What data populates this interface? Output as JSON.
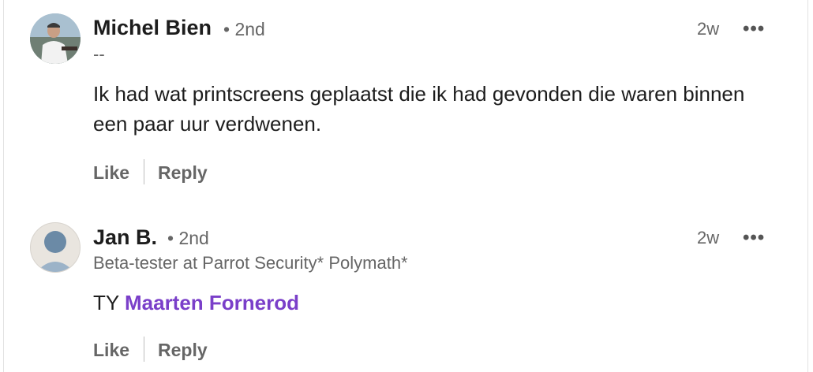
{
  "comments": [
    {
      "author": "Michel Bien",
      "degree": "• 2nd",
      "subtitle": "--",
      "time": "2w",
      "more_icon": "•••",
      "text": "Ik had wat printscreens geplaatst die ik had gevonden die waren binnen een paar uur verdwenen.",
      "like_label": "Like",
      "reply_label": "Reply"
    },
    {
      "author": "Jan B.",
      "degree": "• 2nd",
      "subtitle": "Beta-tester at Parrot Security* Polymath*",
      "time": "2w",
      "more_icon": "•••",
      "text_prefix": "TY ",
      "mention": "Maarten Fornerod",
      "like_label": "Like",
      "reply_label": "Reply"
    }
  ]
}
